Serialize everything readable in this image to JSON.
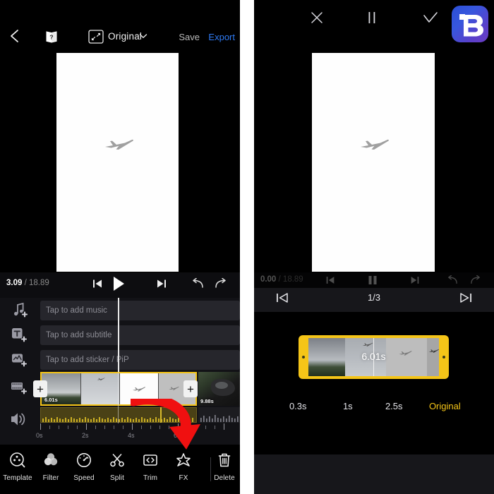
{
  "app": {
    "name": "video-editor",
    "accent_yellow": "#f5c518",
    "accent_blue": "#2f7bf5",
    "background": "#000000",
    "panel_background": "#121216"
  },
  "logo": {
    "name": "ib-logo",
    "text": "IB"
  },
  "left_panel": {
    "header": {
      "back_icon": "chevron-left-icon",
      "help_icon": "help-manual-icon",
      "ratio_icon": "aspect-ratio-icon",
      "ratio_label": "Original",
      "ratio_chevron": "chevron-down-icon",
      "save_label": "Save",
      "export_label": "Export"
    },
    "preview": {
      "plane_icon": "airplane-silhouette"
    },
    "transport": {
      "current_time": "3.09",
      "separator": " / ",
      "total_time": "18.89",
      "prev_frame_icon": "skip-previous-icon",
      "play_icon": "play-icon",
      "next_frame_icon": "skip-next-icon",
      "undo_icon": "undo-icon",
      "redo_icon": "redo-icon"
    },
    "tracks": [
      {
        "icon": "add-music-icon",
        "name": "music-track",
        "placeholder": "Tap to add music"
      },
      {
        "icon": "add-text-icon",
        "name": "subtitle-track",
        "placeholder": "Tap to add subtitle"
      },
      {
        "icon": "add-sticker-icon",
        "name": "sticker-track",
        "placeholder": "Tap to add sticker / PiP"
      }
    ],
    "video_track": {
      "icon": "film-strip-icon",
      "volume_icon": "volume-icon",
      "add_left_label": "+",
      "add_right_label": "+",
      "clips": [
        {
          "duration": "6.01s",
          "selected": true
        },
        {
          "duration": "9.88s",
          "selected": false
        }
      ]
    },
    "ruler": {
      "labels": [
        "0s",
        "2s",
        "4s",
        "6s"
      ]
    },
    "toolbar": [
      {
        "icon": "template-icon",
        "label": "Template"
      },
      {
        "icon": "filter-icon",
        "label": "Filter"
      },
      {
        "icon": "speed-icon",
        "label": "Speed"
      },
      {
        "icon": "split-icon",
        "label": "Split"
      },
      {
        "icon": "trim-icon",
        "label": "Trim"
      },
      {
        "icon": "fx-icon",
        "label": "FX"
      },
      {
        "icon": "delete-icon",
        "label": "Delete"
      }
    ],
    "annotation": {
      "icon": "red-curved-arrow",
      "color": "#f01010"
    }
  },
  "right_panel": {
    "transport": {
      "current_time": "0.00",
      "separator": " / ",
      "total_time": "18.89",
      "prev_frame_icon": "skip-previous-icon",
      "pause_icon": "pause-icon",
      "next_frame_icon": "skip-next-icon",
      "undo_icon": "undo-icon",
      "redo_icon": "redo-icon"
    },
    "preview": {
      "plane_icon": "airplane-silhouette"
    },
    "clip_nav": {
      "prev_icon": "prev-clip-icon",
      "counter": "1/3",
      "next_icon": "next-clip-icon"
    },
    "trim": {
      "duration_label": "6.01s",
      "left_handle": "trim-handle-left",
      "right_handle": "trim-handle-right"
    },
    "duration_options": [
      {
        "label": "0.3s",
        "selected": false
      },
      {
        "label": "1s",
        "selected": false
      },
      {
        "label": "2.5s",
        "selected": false
      },
      {
        "label": "Original",
        "selected": true
      }
    ],
    "bottom_bar": {
      "cancel_icon": "close-icon",
      "pause_icon": "pause-icon",
      "confirm_icon": "check-icon"
    }
  }
}
